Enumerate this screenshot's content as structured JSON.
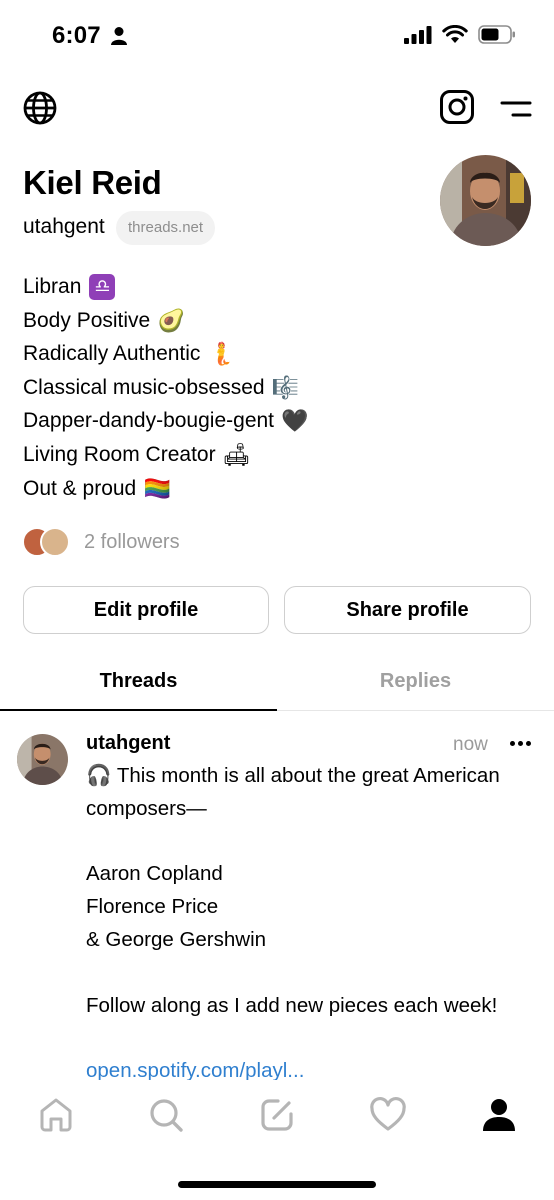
{
  "status_bar": {
    "time": "6:07"
  },
  "profile": {
    "name": "Kiel Reid",
    "handle": "utahgent",
    "domain_chip": "threads.net",
    "bio": [
      {
        "text": "Libran",
        "emoji": "♎"
      },
      {
        "text": "Body Positive",
        "emoji": "🥑"
      },
      {
        "text": "Radically Authentic",
        "emoji": "🧜"
      },
      {
        "text": "Classical music-obsessed",
        "emoji": "🎼"
      },
      {
        "text": "Dapper-dandy-bougie-gent",
        "emoji": "🖤"
      },
      {
        "text": "Living Room Creator",
        "emoji": "🛋"
      },
      {
        "text": "Out & proud",
        "emoji": "🏳️‍🌈"
      }
    ],
    "followers_text": "2 followers"
  },
  "buttons": {
    "edit": "Edit profile",
    "share": "Share profile"
  },
  "tabs": [
    {
      "label": "Threads",
      "active": true
    },
    {
      "label": "Replies",
      "active": false
    }
  ],
  "post": {
    "user": "utahgent",
    "time": "now",
    "lines": [
      "🎧 This month is all about the great American",
      "composers—",
      "",
      "Aaron Copland",
      "Florence Price",
      "& George Gershwin",
      "",
      "Follow along as I add new pieces each week!",
      ""
    ],
    "link": "open.spotify.com/playl..."
  },
  "icons": {
    "globe": "globe-icon",
    "instagram": "instagram-icon",
    "menu": "menu-icon",
    "nav": [
      "home-icon",
      "search-icon",
      "compose-icon",
      "heart-icon",
      "profile-icon"
    ]
  },
  "colors": {
    "link": "#2f7fcf",
    "muted": "#9a9a9a",
    "chip_bg": "#f2f2f2"
  }
}
